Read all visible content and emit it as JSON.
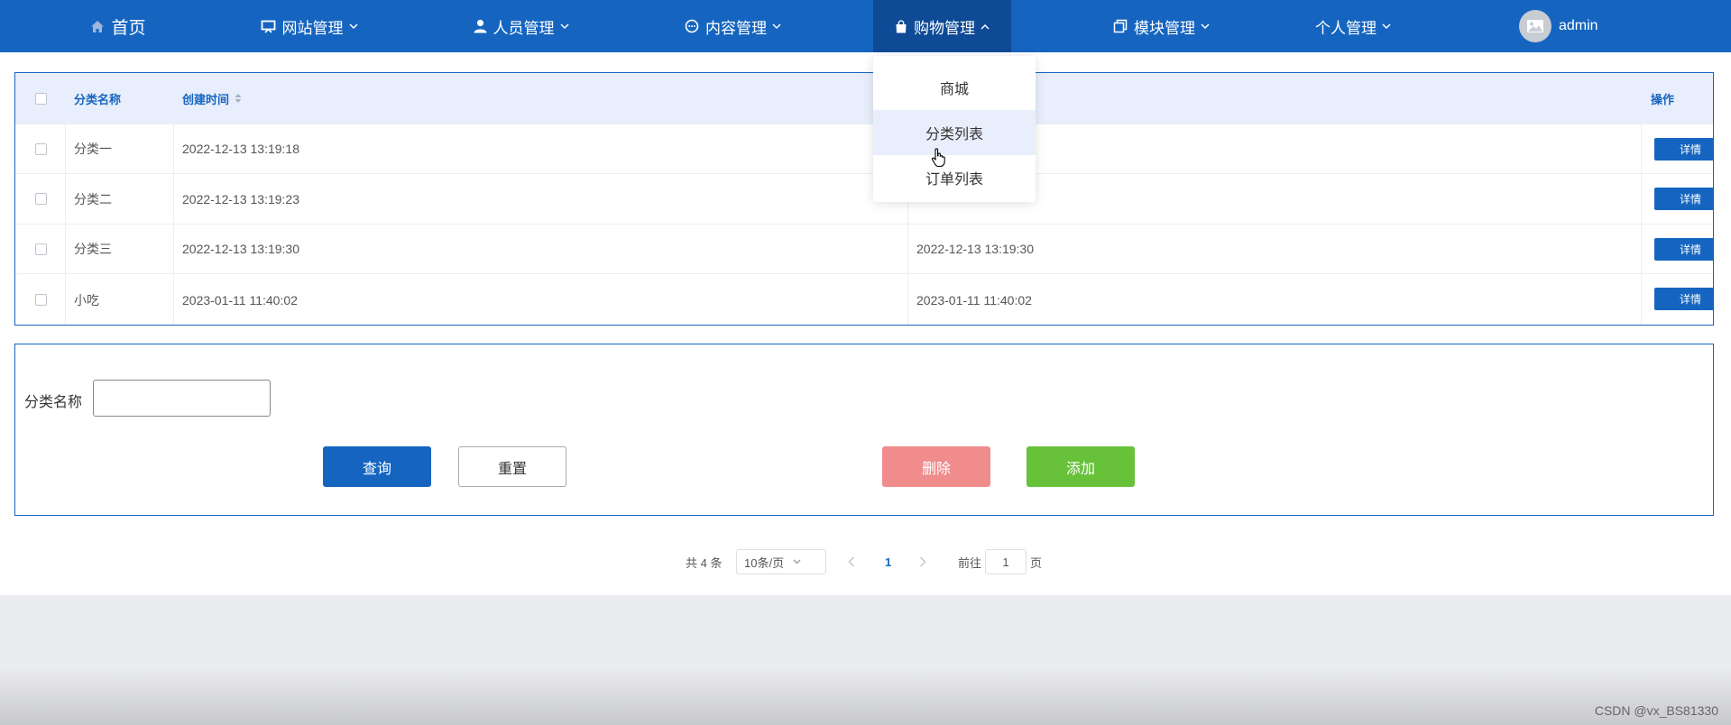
{
  "nav": {
    "home": "首页",
    "items": [
      "网站管理",
      "人员管理",
      "内容管理",
      "购物管理",
      "模块管理",
      "个人管理"
    ],
    "user": "admin"
  },
  "table": {
    "headers": {
      "name": "分类名称",
      "created": "创建时间",
      "action": "操作"
    },
    "rows": [
      {
        "name": "分类一",
        "created": "2022-12-13 13:19:18",
        "updated": ""
      },
      {
        "name": "分类二",
        "created": "2022-12-13 13:19:23",
        "updated": ""
      },
      {
        "name": "分类三",
        "created": "2022-12-13 13:19:30",
        "updated": "2022-12-13 13:19:30"
      },
      {
        "name": "小吃",
        "created": "2023-01-11 11:40:02",
        "updated": "2023-01-11 11:40:02"
      }
    ],
    "detail_label": "详情"
  },
  "dropdown": {
    "items": [
      "商城",
      "分类列表",
      "订单列表"
    ]
  },
  "form": {
    "label": "分类名称",
    "input_value": "",
    "query": "查询",
    "reset": "重置",
    "delete": "删除",
    "add": "添加"
  },
  "pagination": {
    "total": "共 4 条",
    "page_size": "10条/页",
    "current": "1",
    "goto_prefix": "前往",
    "goto_value": "1",
    "goto_suffix": "页"
  },
  "watermark": "CSDN @vx_BS81330",
  "colors": {
    "primary": "#1565c0",
    "danger": "#f08c8c",
    "success": "#67c23a"
  }
}
